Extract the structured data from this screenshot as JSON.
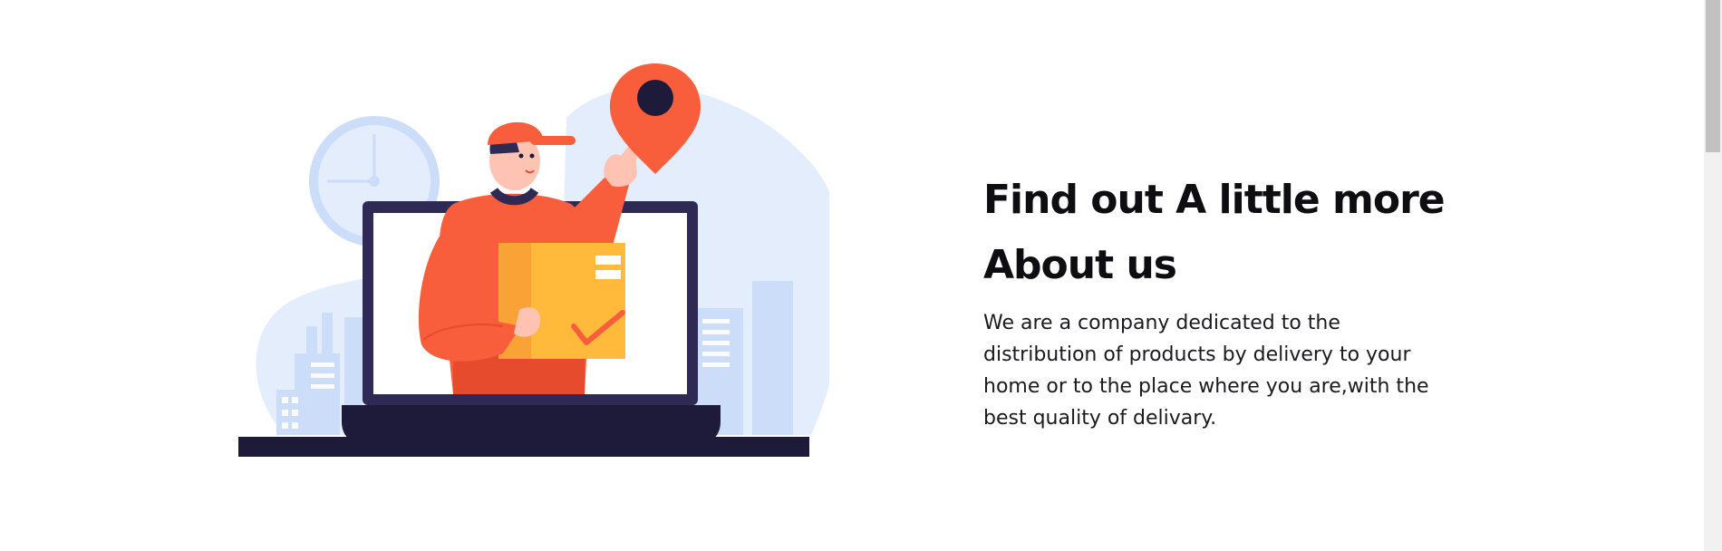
{
  "about": {
    "title_line1": "Find out A little more",
    "title_line2": "About us",
    "description": "We are a company dedicated to the distribution of products by delivery to your home or to the place where you are,with the best quality of delivary."
  },
  "illustration": {
    "subject": "delivery courier holding a box emerging from a laptop screen",
    "icons": [
      "clock-icon",
      "map-pin-icon",
      "package-box",
      "laptop",
      "city-buildings"
    ]
  },
  "colors": {
    "accent_orange": "#F85E3C",
    "box_yellow": "#FFBA3B",
    "navy": "#1E1B3A",
    "light_blue": "#E4EDFB",
    "building_blue": "#CCDDFA"
  }
}
